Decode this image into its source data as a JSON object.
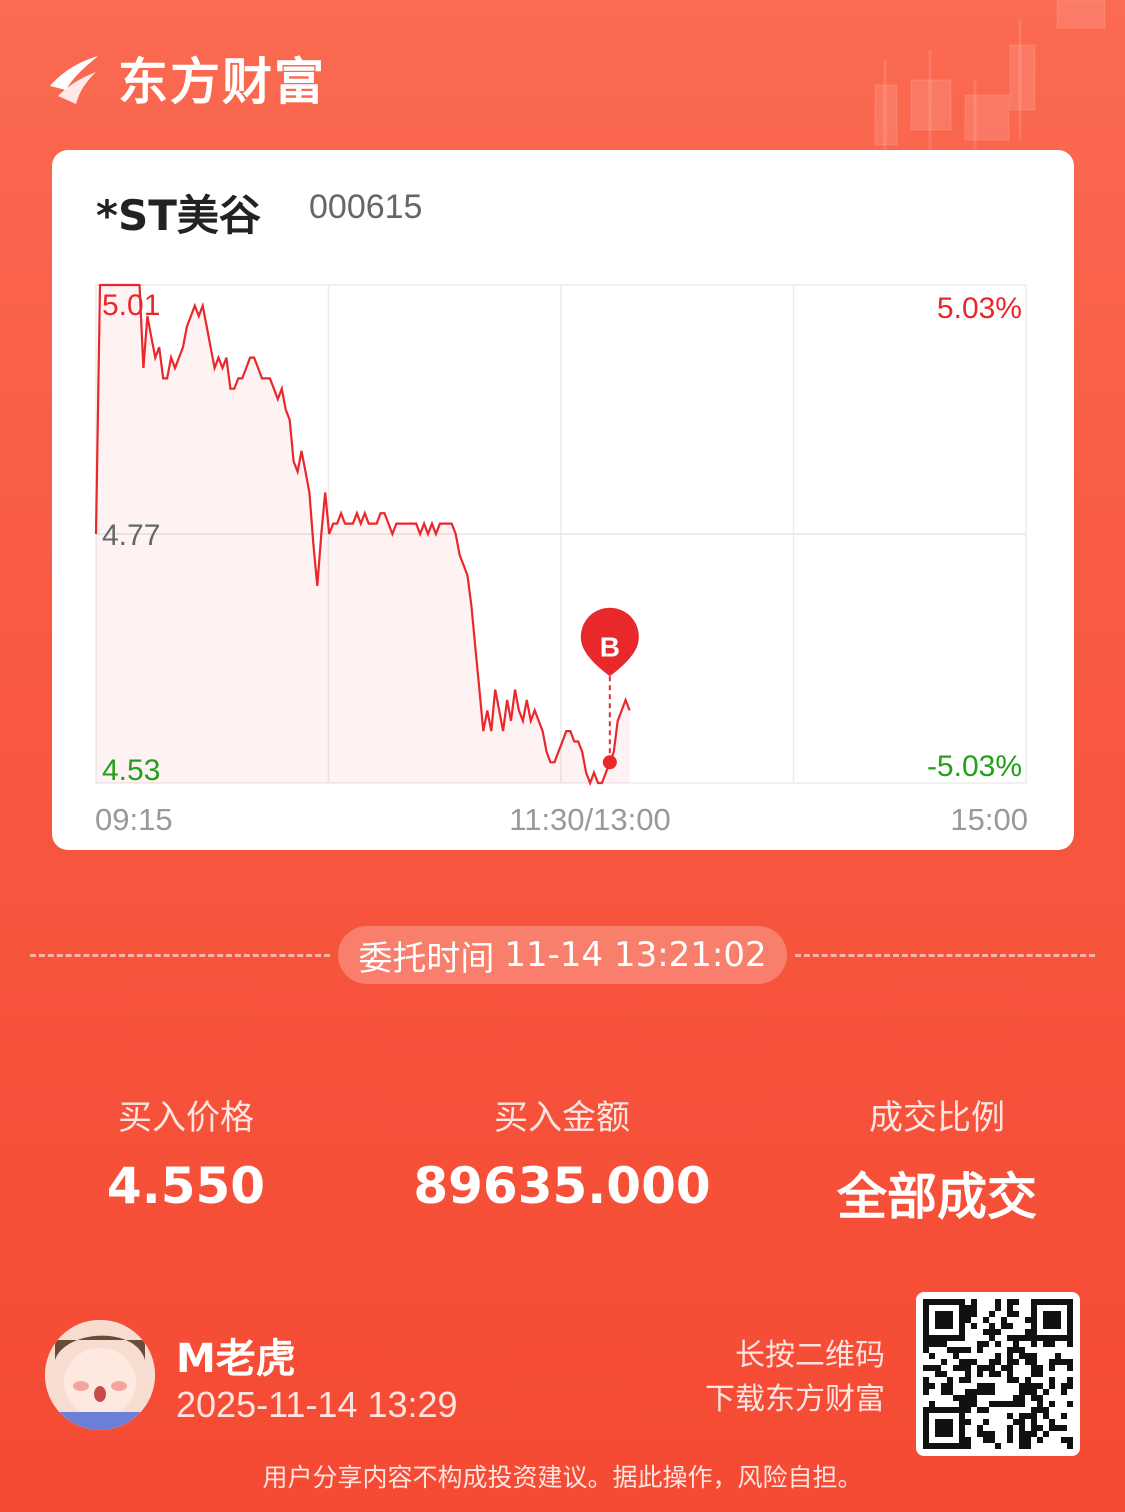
{
  "brand": {
    "name": "东方财富"
  },
  "stock": {
    "name": "*ST美谷",
    "code": "000615"
  },
  "chart_data": {
    "type": "line",
    "title": "",
    "y_left_ticks": [
      "5.01",
      "4.77",
      "4.53"
    ],
    "y_right_ticks": [
      "5.03%",
      "",
      "-5.03%"
    ],
    "x_ticks": [
      "09:15",
      "11:30/13:00",
      "15:00"
    ],
    "ylim": [
      4.53,
      5.01
    ],
    "prev_close": 4.77,
    "grid": true,
    "line_color": "#e8282b",
    "up_color": "#e8282b",
    "down_color": "#22a01a",
    "marker": {
      "label": "B",
      "time_index": 130,
      "price": 4.55
    },
    "series": [
      {
        "values": [
          4.77,
          5.01,
          5.01,
          5.01,
          5.01,
          5.01,
          5.01,
          5.01,
          5.01,
          5.01,
          5.01,
          5.01,
          4.93,
          4.98,
          4.96,
          4.94,
          4.95,
          4.92,
          4.92,
          4.94,
          4.93,
          4.94,
          4.95,
          4.97,
          4.98,
          4.99,
          4.98,
          4.99,
          4.97,
          4.95,
          4.93,
          4.94,
          4.93,
          4.94,
          4.91,
          4.91,
          4.92,
          4.92,
          4.93,
          4.94,
          4.94,
          4.93,
          4.92,
          4.92,
          4.92,
          4.91,
          4.9,
          4.91,
          4.89,
          4.88,
          4.84,
          4.83,
          4.85,
          4.83,
          4.81,
          4.76,
          4.72,
          4.77,
          4.81,
          4.77,
          4.78,
          4.78,
          4.79,
          4.78,
          4.78,
          4.78,
          4.79,
          4.78,
          4.79,
          4.78,
          4.78,
          4.78,
          4.79,
          4.79,
          4.78,
          4.77,
          4.78,
          4.78,
          4.78,
          4.78,
          4.78,
          4.78,
          4.77,
          4.78,
          4.77,
          4.78,
          4.77,
          4.78,
          4.78,
          4.78,
          4.78,
          4.77,
          4.75,
          4.74,
          4.73,
          4.7,
          4.66,
          4.62,
          4.58,
          4.6,
          4.58,
          4.62,
          4.6,
          4.58,
          4.61,
          4.59,
          4.62,
          4.6,
          4.59,
          4.61,
          4.59,
          4.6,
          4.59,
          4.58,
          4.56,
          4.55,
          4.55,
          4.56,
          4.57,
          4.58,
          4.58,
          4.57,
          4.57,
          4.56,
          4.54,
          4.53,
          4.54,
          4.53,
          4.53,
          4.54,
          4.55,
          4.56,
          4.59,
          4.6,
          4.61,
          4.6
        ]
      }
    ]
  },
  "order": {
    "label": "委托时间",
    "time": "11-14 13:21:02"
  },
  "stats": {
    "buy_price_label": "买入价格",
    "buy_price": "4.550",
    "buy_amount_label": "买入金额",
    "buy_amount": "89635.000",
    "fill_label": "成交比例",
    "fill_value": "全部成交"
  },
  "user": {
    "name": "M老虎",
    "time": "2025-11-14 13:29"
  },
  "qr_hint": {
    "line1": "长按二维码",
    "line2": "下载东方财富"
  },
  "disclaimer": "用户分享内容不构成投资建议。据此操作，风险自担。"
}
